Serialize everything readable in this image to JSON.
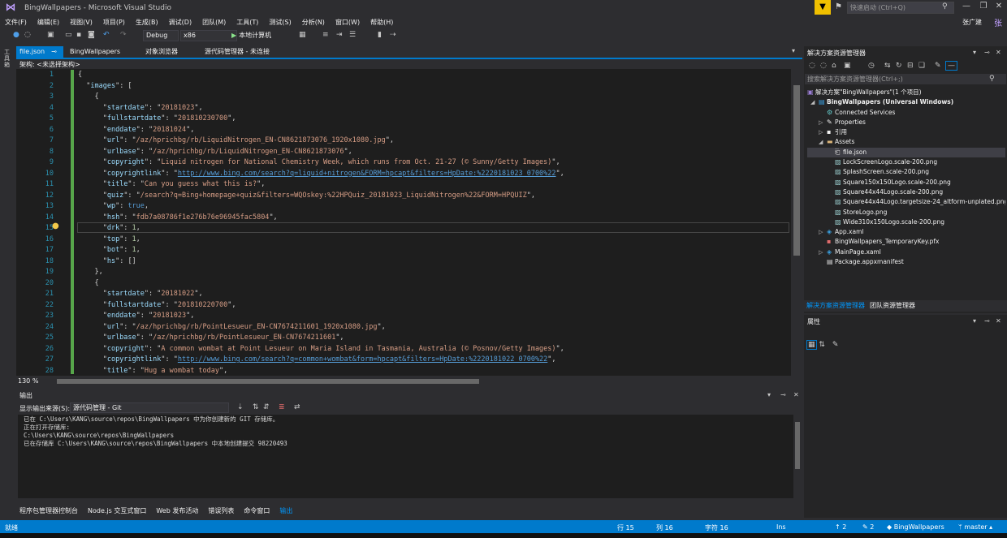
{
  "window": {
    "title": "BingWallpapers - Microsoft Visual Studio",
    "quick_launch_placeholder": "快速启动 (Ctrl+Q)",
    "user_name": "张广建",
    "user_initial": "张"
  },
  "menu": [
    "文件(F)",
    "编辑(E)",
    "视图(V)",
    "项目(P)",
    "生成(B)",
    "调试(D)",
    "团队(M)",
    "工具(T)",
    "测试(S)",
    "分析(N)",
    "窗口(W)",
    "帮助(H)"
  ],
  "toolbar": {
    "config": "Debug",
    "platform": "x86",
    "run_label": "本地计算机"
  },
  "left_strip": "工具箱",
  "tabs": {
    "file_json": "file.json",
    "bingwallpapers": "BingWallpapers",
    "object_browser": "对象浏览器",
    "scm": "源代码管理器 - 未连接"
  },
  "schema_bar": "架构: <未选择架构>",
  "editor": {
    "line_numbers": [
      "1",
      "2",
      "3",
      "4",
      "5",
      "6",
      "7",
      "8",
      "9",
      "10",
      "11",
      "12",
      "13",
      "14",
      "15",
      "16",
      "17",
      "18",
      "19",
      "20",
      "21",
      "22",
      "23",
      "24",
      "25",
      "26",
      "27",
      "28"
    ],
    "zoom": "130 %"
  },
  "json": {
    "images_key": "images",
    "startdate_1": "20181023",
    "fullstartdate_1": "201810230700",
    "enddate_1": "20181024",
    "url_1": "/az/hprichbg/rb/LiquidNitrogen_EN-CN8621873076_1920x1080.jpg",
    "urlbase_1": "/az/hprichbg/rb/LiquidNitrogen_EN-CN8621873076",
    "copyright_1": "Liquid nitrogen for National Chemistry Week, which runs from Oct. 21-27 (© Sunny/Getty Images)",
    "copyrightlink_1": "http://www.bing.com/search?q=liquid+nitrogen&FORM=hpcapt&filters=HpDate:%2220181023_0700%22",
    "title_1": "Can you guess what this is?",
    "quiz_1": "/search?q=Bing+homepage+quiz&filters=WQOskey:%22HPQuiz_20181023_LiquidNitrogen%22&FORM=HPQUIZ",
    "wp_1": "true",
    "hsh_1": "fdb7a08786f1e276b76e96945fac5804",
    "drk_1": "1",
    "top_1": "1",
    "bot_1": "1",
    "hs_1": "[]",
    "startdate_2": "20181022",
    "fullstartdate_2": "201810220700",
    "enddate_2": "20181023",
    "url_2": "/az/hprichbg/rb/PointLesueur_EN-CN7674211601_1920x1080.jpg",
    "urlbase_2": "/az/hprichbg/rb/PointLesueur_EN-CN7674211601",
    "copyright_2": "A common wombat at Point Lesueur on Maria Island in Tasmania, Australia (© Posnov/Getty Images)",
    "copyrightlink_2": "http://www.bing.com/search?q=common+wombat&form=hpcapt&filters=HpDate:%2220181022_0700%22",
    "title_2": "Hug a wombat today"
  },
  "output": {
    "title": "输出",
    "source_label": "显示输出来源(S):",
    "source_value": "源代码管理 - Git",
    "lines": [
      "已在 C:\\Users\\KANG\\source\\repos\\BingWallpapers 中为你创建新的 GIT 存储库。",
      "正在打开存储库:",
      "C:\\Users\\KANG\\source\\repos\\BingWallpapers",
      "已在存储库 C:\\Users\\KANG\\source\\repos\\BingWallpapers 中本地创建提交 98220493"
    ]
  },
  "bottom_tabs": [
    "程序包管理器控制台",
    "Node.js 交互式窗口",
    "Web 发布活动",
    "错误列表",
    "命令窗口",
    "输出"
  ],
  "solution_explorer": {
    "title": "解决方案资源管理器",
    "search_placeholder": "搜索解决方案资源管理器(Ctrl+;)",
    "items": [
      {
        "label": "解决方案\"BingWallpapers\"(1 个项目)"
      },
      {
        "label": "BingWallpapers (Universal Windows)"
      },
      {
        "label": "Connected Services"
      },
      {
        "label": "Properties"
      },
      {
        "label": "引用"
      },
      {
        "label": "Assets"
      },
      {
        "label": "file.json"
      },
      {
        "label": "LockScreenLogo.scale-200.png"
      },
      {
        "label": "SplashScreen.scale-200.png"
      },
      {
        "label": "Square150x150Logo.scale-200.png"
      },
      {
        "label": "Square44x44Logo.scale-200.png"
      },
      {
        "label": "Square44x44Logo.targetsize-24_altform-unplated.png"
      },
      {
        "label": "StoreLogo.png"
      },
      {
        "label": "Wide310x150Logo.scale-200.png"
      },
      {
        "label": "App.xaml"
      },
      {
        "label": "BingWallpapers_TemporaryKey.pfx"
      },
      {
        "label": "MainPage.xaml"
      },
      {
        "label": "Package.appxmanifest"
      }
    ],
    "tab_active": "解决方案资源管理器",
    "tab_team": "团队资源管理器"
  },
  "properties": {
    "title": "属性"
  },
  "status": {
    "ready": "就绪",
    "line": "行 15",
    "col": "列 16",
    "char": "字符 16",
    "ins": "Ins",
    "up_count": "2",
    "pencil_count": "2",
    "repo": "BingWallpapers",
    "branch": "master"
  }
}
